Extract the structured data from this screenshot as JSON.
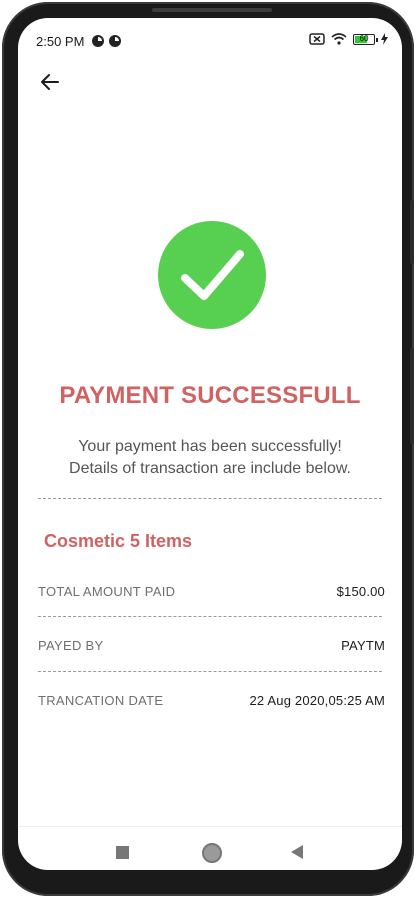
{
  "status_bar": {
    "time": "2:50 PM",
    "battery_level": "60",
    "icons": [
      "app-notification-icon",
      "app-notification-icon",
      "no-sim-icon",
      "wifi-icon",
      "battery-icon",
      "charging-icon"
    ]
  },
  "header": {
    "back_icon": "arrow-left-icon"
  },
  "success": {
    "icon": "checkmark-icon",
    "icon_color": "#57cf51",
    "title": "PAYMENT SUCCESSFULL",
    "title_color": "#d06262",
    "message_line1": "Your payment has been successfully!",
    "message_line2": "Details of transaction are include below."
  },
  "order": {
    "product_title": "Cosmetic 5 Items"
  },
  "details": [
    {
      "label": "TOTAL AMOUNT PAID",
      "value": "$150.00"
    },
    {
      "label": "PAYED BY",
      "value": "PAYTM"
    },
    {
      "label": "TRANCATION DATE",
      "value": "22 Aug 2020,05:25 AM"
    }
  ],
  "nav_bar": {
    "icons": [
      "recents-icon",
      "home-icon",
      "back-triangle-icon"
    ]
  }
}
